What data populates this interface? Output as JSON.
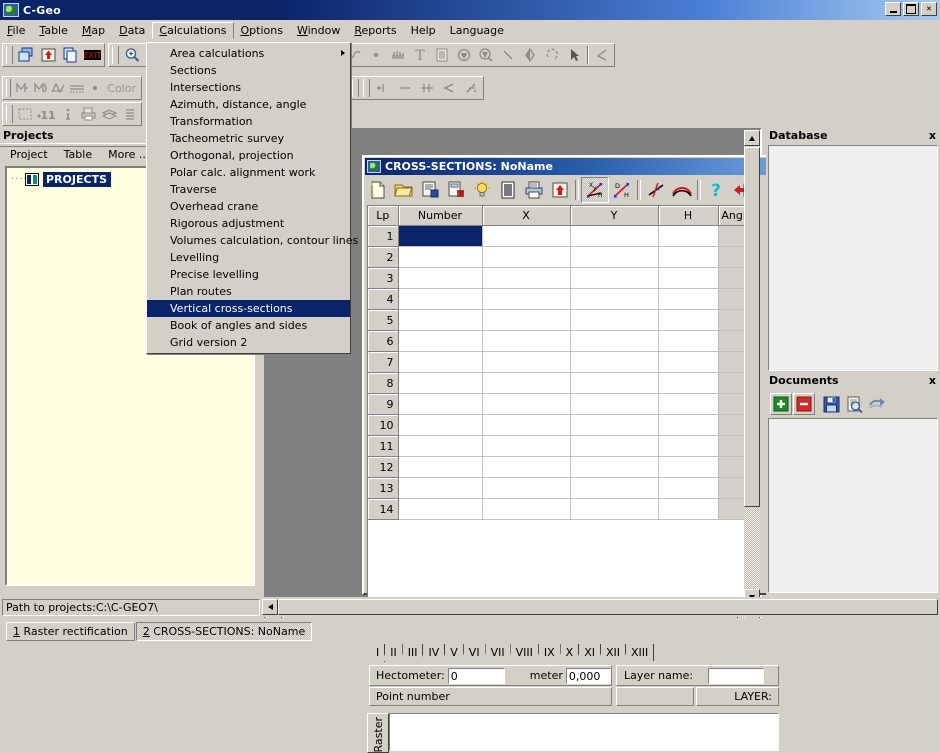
{
  "window": {
    "title": "C-Geo",
    "icon": "globe-icon",
    "controls": {
      "minimize": "_",
      "maximize": "□",
      "close": "✕"
    }
  },
  "menubar": {
    "items": [
      {
        "label": "File",
        "accel": "F"
      },
      {
        "label": "Table",
        "accel": "T"
      },
      {
        "label": "Map",
        "accel": "M"
      },
      {
        "label": "Data",
        "accel": "D"
      },
      {
        "label": "Calculations",
        "accel": "C",
        "open": true
      },
      {
        "label": "Options",
        "accel": "O"
      },
      {
        "label": "Window",
        "accel": "W"
      },
      {
        "label": "Reports",
        "accel": "R"
      },
      {
        "label": "Help",
        "accel": ""
      },
      {
        "label": "Language",
        "accel": ""
      }
    ]
  },
  "calculations_menu": {
    "items": [
      {
        "label": "Area calculations",
        "accel": "A",
        "submenu": true
      },
      {
        "label": "Sections"
      },
      {
        "label": "Intersections"
      },
      {
        "label": "Azimuth, distance, angle",
        "accel": "z"
      },
      {
        "label": "Transformation"
      },
      {
        "label": "Tacheometric survey",
        "accel": "a"
      },
      {
        "label": "Orthogonal, projection",
        "accel": "O"
      },
      {
        "label": "Polar calc. alignment work"
      },
      {
        "label": "Traverse",
        "accel": "v"
      },
      {
        "label": "Overhead crane"
      },
      {
        "label": "Rigorous adjustment"
      },
      {
        "label": "Volumes calculation, contour lines",
        "accel": "u"
      },
      {
        "label": "Levelling",
        "accel": "L"
      },
      {
        "label": "Precise levelling"
      },
      {
        "label": "Plan routes"
      },
      {
        "label": "Vertical cross-sections",
        "selected": true
      },
      {
        "label": "Book of angles and sides"
      },
      {
        "label": "Grid version 2"
      }
    ]
  },
  "toolbar": {
    "row1": [
      {
        "icon": "copy-windows-icon",
        "disabled": false
      },
      {
        "icon": "export-up-icon",
        "disabled": false
      },
      {
        "icon": "duplicate-icon",
        "disabled": false
      },
      {
        "icon": "exit-icon",
        "disabled": false
      }
    ],
    "row1b": [
      {
        "icon": "zoom-in-icon"
      },
      {
        "icon": "zoom-out-icon"
      },
      {
        "icon": "zoom-window-icon"
      }
    ],
    "row1c": [
      {
        "icon": "rotate-icon"
      },
      {
        "icon": "circle-icon"
      },
      {
        "icon": "arc-icon"
      },
      {
        "icon": "spline-icon"
      },
      {
        "icon": "point-icon"
      },
      {
        "icon": "hatch-icon"
      },
      {
        "icon": "text-icon"
      },
      {
        "icon": "table-icon"
      },
      {
        "icon": "symbol-icon"
      },
      {
        "icon": "symbol-search-icon"
      },
      {
        "icon": "line-icon"
      },
      {
        "icon": "mirror-icon"
      },
      {
        "icon": "rotate-object-icon"
      },
      {
        "icon": "select-arrow-icon"
      },
      {
        "icon": "angle-icon"
      }
    ],
    "row2": [
      {
        "icon": "map-left-icon"
      },
      {
        "icon": "map-right-icon"
      },
      {
        "icon": "dtm-icon"
      },
      {
        "icon": "grid-icon"
      },
      {
        "icon": "dot-icon"
      },
      {
        "label": "Color"
      }
    ],
    "row2b": [
      {
        "icon": "point-dim-icon"
      },
      {
        "icon": "dim-line-icon"
      },
      {
        "icon": "perpendicular-icon"
      },
      {
        "icon": "arrow-left-icon"
      },
      {
        "icon": "slash-icon"
      }
    ],
    "row3": [
      {
        "icon": "marquee-select-icon"
      },
      {
        "icon": "number-11-icon"
      },
      {
        "icon": "info-icon"
      },
      {
        "icon": "print-icon"
      },
      {
        "icon": "layers-icon"
      },
      {
        "icon": "list-icon"
      }
    ]
  },
  "projects_dock": {
    "title": "Projects",
    "menu": [
      "Project",
      "Table",
      "More ..."
    ],
    "tree": [
      {
        "label": "PROJECTS",
        "icon": "book-icon",
        "selected": true
      }
    ]
  },
  "cross_sections_window": {
    "title": "CROSS-SECTIONS: NoName",
    "icon": "globe-icon",
    "toolbar": [
      {
        "icon": "new-document-icon"
      },
      {
        "icon": "open-folder-icon"
      },
      {
        "icon": "save-document-icon"
      },
      {
        "icon": "save-as-icon"
      },
      {
        "icon": "bulb-icon"
      },
      {
        "icon": "report-lines-icon"
      },
      {
        "icon": "print-icon"
      },
      {
        "icon": "export-up-red-icon"
      },
      {
        "icon": "xyh-axes-icon",
        "pressed": true
      },
      {
        "icon": "dh-line-icon"
      },
      {
        "icon": "cross-line-icon"
      },
      {
        "icon": "arch-profile-icon"
      },
      {
        "icon": "help-question-icon"
      },
      {
        "icon": "exit-red-arrow-icon"
      }
    ],
    "grid": {
      "columns": [
        "Lp",
        "Number",
        "X",
        "Y",
        "H",
        "Angle"
      ],
      "rows": [
        {
          "lp": "1",
          "number": "",
          "x": "",
          "y": "",
          "h": "",
          "angle": "",
          "selected_cell": "number"
        },
        {
          "lp": "2",
          "number": "",
          "x": "",
          "y": "",
          "h": "",
          "angle": ""
        },
        {
          "lp": "3",
          "number": "",
          "x": "",
          "y": "",
          "h": "",
          "angle": ""
        },
        {
          "lp": "4",
          "number": "",
          "x": "",
          "y": "",
          "h": "",
          "angle": ""
        },
        {
          "lp": "5",
          "number": "",
          "x": "",
          "y": "",
          "h": "",
          "angle": ""
        },
        {
          "lp": "6",
          "number": "",
          "x": "",
          "y": "",
          "h": "",
          "angle": ""
        },
        {
          "lp": "7",
          "number": "",
          "x": "",
          "y": "",
          "h": "",
          "angle": ""
        },
        {
          "lp": "8",
          "number": "",
          "x": "",
          "y": "",
          "h": "",
          "angle": ""
        },
        {
          "lp": "9",
          "number": "",
          "x": "",
          "y": "",
          "h": "",
          "angle": ""
        },
        {
          "lp": "10",
          "number": "",
          "x": "",
          "y": "",
          "h": "",
          "angle": ""
        },
        {
          "lp": "11",
          "number": "",
          "x": "",
          "y": "",
          "h": "",
          "angle": ""
        },
        {
          "lp": "12",
          "number": "",
          "x": "",
          "y": "",
          "h": "",
          "angle": ""
        },
        {
          "lp": "13",
          "number": "",
          "x": "",
          "y": "",
          "h": "",
          "angle": ""
        },
        {
          "lp": "14",
          "number": "",
          "x": "",
          "y": "",
          "h": "",
          "angle": ""
        }
      ]
    },
    "section_tabs": [
      "I",
      "II",
      "III",
      "IV",
      "V",
      "VI",
      "VII",
      "VIII",
      "IX",
      "X",
      "XI",
      "XII",
      "XIII"
    ],
    "active_section_tab": "I",
    "fields": {
      "hectometer_label": "Hectometer:",
      "hectometer_value": "0",
      "meter_label": "meter",
      "meter_value": "0,000",
      "point_number_label": "Point number",
      "layer_name_label": "Layer name:",
      "layer_name_value": "",
      "layer_status": "LAYER:"
    },
    "raster_tab": "Raster"
  },
  "database_dock": {
    "title": "Database",
    "close": "x"
  },
  "documents_dock": {
    "title": "Documents",
    "close": "x",
    "tools": [
      {
        "icon": "add-plus-icon",
        "color": "#1a8a1a"
      },
      {
        "icon": "remove-minus-icon",
        "color": "#d42a2a"
      },
      {
        "icon": "save-floppy-icon",
        "color": "#2a4a9a"
      },
      {
        "icon": "preview-icon",
        "color": "#5a7aa8"
      },
      {
        "icon": "export-arrow-icon",
        "color": "#6a8ab0"
      }
    ]
  },
  "statusbar": {
    "path": "Path to projects:C:\\C-GEO7\\"
  },
  "taskbar": {
    "items": [
      {
        "num": "1",
        "label": " Raster rectification",
        "active": false
      },
      {
        "num": "2",
        "label": " CROSS-SECTIONS: NoName",
        "active": true
      }
    ]
  }
}
